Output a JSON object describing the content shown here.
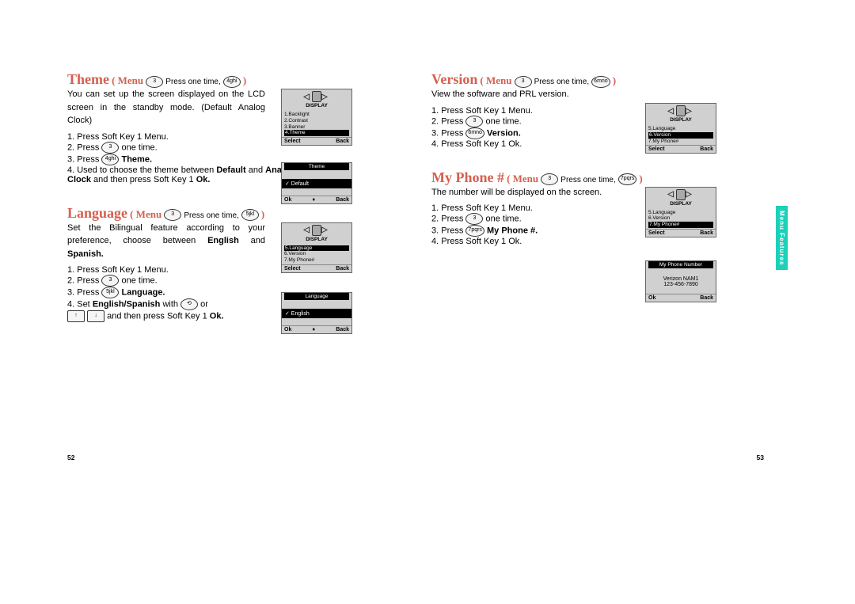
{
  "page_left": "52",
  "page_right": "53",
  "side_tab": "Menu Features",
  "sections": {
    "theme": {
      "title": "Theme",
      "menu": "( Menu",
      "hint_mid": "Press one time,",
      "k1": "3",
      "k2": "4ghi",
      "close": ")",
      "intro": "You can set up the screen displayed on the LCD screen in the standby mode. (Default  Analog Clock)",
      "s1": "1. Press Soft Key 1 Menu.",
      "s2a": "2. Press",
      "s2k": "3",
      "s2b": "one time.",
      "s3a": "3. Press",
      "s3k": "4ghi",
      "s3b": "Theme.",
      "s4a": "4. Used to choose the theme between",
      "s4b": "Default",
      "s4c": "and",
      "s4d": "Analog Clock",
      "s4e": "and then press Soft Key 1",
      "s4f": "Ok.",
      "lcd1": {
        "header": "DISPLAY",
        "i1": "1.Backlight",
        "i2": "2.Contrast",
        "i3": "3.Banner",
        "hi": "4.Theme",
        "fl": "Select",
        "fr": "Back"
      },
      "lcd2": {
        "sel": "Theme",
        "row": "✓ Default",
        "fl": "Ok",
        "fr": "Back"
      }
    },
    "language": {
      "title": "Language",
      "menu": "( Menu",
      "hint_mid": "Press one time,",
      "k1": "3",
      "k2": "5jkl",
      "close": ")",
      "intro_a": "Set the Bilingual feature according to your preference, choose between",
      "intro_b": "English",
      "intro_c": "and",
      "intro_d": "Spanish.",
      "s1": "1. Press Soft Key 1 Menu.",
      "s2a": "2. Press",
      "s2k": "3",
      "s2b": "one time.",
      "s3a": "3. Press",
      "s3k": "5jkl",
      "s3b": "Language.",
      "s4a": "4. Set",
      "s4b": "English/Spanish",
      "s4c": "with",
      "s4k1": "⟲",
      "s4d": "or",
      "s5k1": "↑",
      "s5k2": "↓",
      "s5a": "and then press Soft Key 1",
      "s5b": "Ok.",
      "lcd1": {
        "header": "DISPLAY",
        "hi": "5.Language",
        "i2": "6.Version",
        "i3": "7.My Phone#",
        "fl": "Select",
        "fr": "Back"
      },
      "lcd2": {
        "sel": "Language",
        "row": "✓ English",
        "fl": "Ok",
        "fr": "Back"
      }
    },
    "version": {
      "title": "Version",
      "menu": "( Menu",
      "hint_mid": "Press one time,",
      "k1": "3",
      "k2": "6mno",
      "close": ")",
      "intro": "View the software and PRL version.",
      "s1": "1. Press Soft Key 1 Menu.",
      "s2a": "2. Press",
      "s2k": "3",
      "s2b": "one time.",
      "s3a": "3. Press",
      "s3k": "6mno",
      "s3b": "Version.",
      "s4": "4. Press Soft Key 1 Ok.",
      "lcd1": {
        "header": "DISPLAY",
        "i1": "5.Language",
        "hi": "6.Version",
        "i3": "7.My Phone#",
        "fl": "Select",
        "fr": "Back"
      }
    },
    "myphone": {
      "title": "My Phone #",
      "menu": "( Menu",
      "hint_mid": "Press one time,",
      "k1": "3",
      "k2": "7pqrs",
      "close": ")",
      "intro": "The number will be displayed on the screen.",
      "s1": "1. Press Soft Key 1 Menu.",
      "s2a": "2. Press",
      "s2k": "3",
      "s2b": "one time.",
      "s3a": "3. Press",
      "s3k": "7pqrs",
      "s3b": "My Phone #.",
      "s4": "4. Press Soft Key 1 Ok.",
      "lcd1": {
        "header": "DISPLAY",
        "i1": "5.Language",
        "i2": "6.Version",
        "hi": "7.My Phone#",
        "fl": "Select",
        "fr": "Back"
      },
      "lcd2": {
        "sel": "My Phone Number",
        "r1": "Verizon NAM1",
        "r2": "123-456-7890",
        "fl": "Ok",
        "fr": "Back"
      }
    }
  }
}
